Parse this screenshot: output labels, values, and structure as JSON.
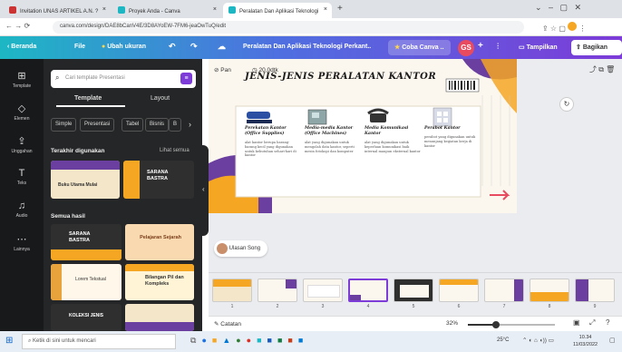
{
  "browser": {
    "tabs": [
      {
        "label": "Invitation UNAS ARTIKEL A.N. ?",
        "active": false
      },
      {
        "label": "Proyek Anda - Canva",
        "active": false
      },
      {
        "label": "Peralatan Dan Aplikasi Teknologi",
        "active": true
      }
    ],
    "url": "canva.com/design/DAE8bCanV4E/3D8AYoEW-7FM6-jeaOwTuQ/edit"
  },
  "toolbar": {
    "home": "Beranda",
    "file": "File",
    "resize": "Ubah ukuran",
    "doc_title": "Peralatan Dan Aplikasi Teknologi Perkant..",
    "try_pro": "Coba Canva ..",
    "avatar": "GS",
    "plus": "+",
    "present": "Tampilkan",
    "share": "Bagikan",
    "undo": "↶",
    "redo": "↷",
    "cloud": "☁"
  },
  "rail": [
    {
      "icon": "⊞",
      "label": "Template"
    },
    {
      "icon": "◇",
      "label": "Elemen"
    },
    {
      "icon": "⇪",
      "label": "Unggahan"
    },
    {
      "icon": "T",
      "label": "Teks"
    },
    {
      "icon": "♫",
      "label": "Audio"
    },
    {
      "icon": "⋯",
      "label": "Lainnya"
    }
  ],
  "panel": {
    "search_placeholder": "Cari template Presentasi",
    "tab_template": "Template",
    "tab_layout": "Layout",
    "chips": [
      "Simple",
      "Presentasi",
      "Tabel",
      "Bisnis",
      "B"
    ],
    "recent_heading": "Terakhir digunakan",
    "see_all": "Lihat semua",
    "all_results": "Semua hasil",
    "thumbs": [
      {
        "t": "Buku Utama Mulai"
      },
      {
        "t": "SARANA BASTRA"
      },
      {
        "t": "SARANA BASTRA"
      },
      {
        "t": "Pelajaran Sejarah"
      },
      {
        "t": "Lorem Tekstual"
      },
      {
        "t": "Bilangan Pil dan Kompleks"
      },
      {
        "t": "KOLEKSI JENIS"
      },
      {
        "t": ""
      }
    ]
  },
  "canvas": {
    "page_label": "Pan",
    "duration": "20.0dtk",
    "undo_icon": "↶",
    "collab_name": "Ulasan Song",
    "slide": {
      "title": "JENIS-JENIS PERALATAN KANTOR",
      "items": [
        {
          "heading": "Perekatan Kantor (Office Supplies)",
          "desc": "alat kantor berupa barang-barang kecil yang digunakan untuk kebutuhan sehari-hari di kantor"
        },
        {
          "heading": "Media-media Kantor (Office Machines)",
          "desc": "alat yang digunakan untuk mengolah data kantor, seperti mesin fotokopi dan komputer"
        },
        {
          "heading": "Media Komunikasi Kantor",
          "desc": "alat yang digunakan untuk keperluan komunikasi baik internal maupun eksternal kantor"
        },
        {
          "heading": "Perabot Kantor",
          "desc": "perabot yang digunakan untuk menunjang kegiatan kerja di kantor"
        }
      ]
    }
  },
  "filmstrip": {
    "pages": [
      "1",
      "2",
      "3",
      "4",
      "5",
      "6",
      "7",
      "8",
      "9"
    ],
    "selected": 4
  },
  "status": {
    "notes": "Catatan",
    "zoom": "32%",
    "zoom_fraction": 0.32
  },
  "taskbar": {
    "search": "Ketik di sini untuk mencari",
    "weather": "25°C",
    "time": "10.34",
    "date": "11/03/2022"
  },
  "colors": {
    "accent": "#7d3bd8",
    "teal": "#1db7c4",
    "orange": "#f5a623",
    "purple": "#6b3fa0"
  }
}
